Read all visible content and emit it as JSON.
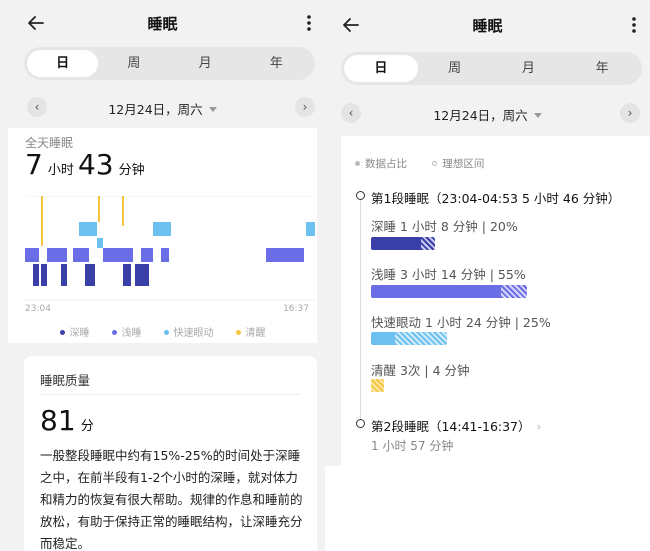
{
  "header": {
    "title": "睡眠"
  },
  "tabs": [
    "日",
    "周",
    "月",
    "年"
  ],
  "date": {
    "label": "12月24日，周六"
  },
  "left": {
    "all_day_label": "全天睡眠",
    "hours": "7",
    "hours_unit": "小时",
    "minutes": "43",
    "minutes_unit": "分钟",
    "chart_start_time": "23:04",
    "chart_end_time": "16:37",
    "legend": [
      {
        "label": "深睡",
        "color": "#3b3fa8"
      },
      {
        "label": "浅睡",
        "color": "#6a6de6"
      },
      {
        "label": "快速眼动",
        "color": "#6cc1f0"
      },
      {
        "label": "清醒",
        "color": "#f5c542"
      }
    ],
    "quality_title": "睡眠质量",
    "score": "81",
    "score_unit": "分",
    "description": "一般整段睡眠中约有15%-25%的时间处于深睡之中，在前半段有1-2个小时的深睡，就对体力和精力的恢复有很大帮助。规律的作息和睡前的放松，有助于保持正常的睡眠结构，让深睡充分而稳定。"
  },
  "right": {
    "legend_ratio": "数据占比",
    "legend_ideal": "理想区间",
    "segment1": {
      "title": "第1段睡眠（23:04-04:53  5 小时 46 分钟）",
      "deep": {
        "label": "深睡   1 小时 8 分钟 | 20%",
        "ratio": 0.2
      },
      "light": {
        "label": "浅睡   3 小时 14 分钟 | 55%",
        "ratio": 0.55
      },
      "rem": {
        "label": "快速眼动   1 小时 24 分钟 | 25%",
        "ratio": 0.25
      },
      "awake": {
        "label": "清醒   3次 | 4 分钟"
      }
    },
    "segment2": {
      "title": "第2段睡眠（14:41-16:37）",
      "duration": "1 小时 57 分钟"
    }
  },
  "colors": {
    "deep": "#3b3fa8",
    "light": "#6a6de6",
    "rem": "#6cc1f0",
    "awake": "#f5c542"
  }
}
